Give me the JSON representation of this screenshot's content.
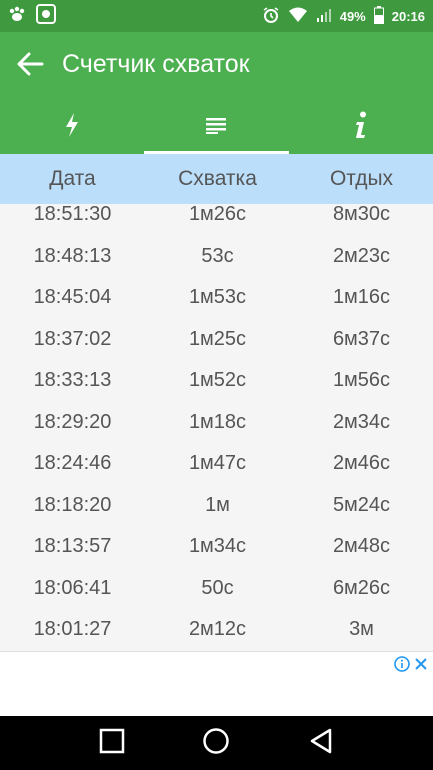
{
  "status_bar": {
    "battery_percent": "49%",
    "time": "20:16"
  },
  "app_bar": {
    "title": "Счетчик схваток"
  },
  "tabs": [
    {
      "name": "contractions",
      "icon": "lightning-icon",
      "active": false
    },
    {
      "name": "history",
      "icon": "list-icon",
      "active": true
    },
    {
      "name": "info",
      "icon": "info-icon",
      "active": false
    }
  ],
  "table": {
    "columns": [
      "Дата",
      "Схватка",
      "Отдых"
    ],
    "rows": [
      [
        "18:51:30",
        "1м26с",
        "8м30с"
      ],
      [
        "18:48:13",
        "53с",
        "2м23с"
      ],
      [
        "18:45:04",
        "1м53с",
        "1м16с"
      ],
      [
        "18:37:02",
        "1м25с",
        "6м37с"
      ],
      [
        "18:33:13",
        "1м52с",
        "1м56с"
      ],
      [
        "18:29:20",
        "1м18с",
        "2м34с"
      ],
      [
        "18:24:46",
        "1м47с",
        "2м46с"
      ],
      [
        "18:18:20",
        "1м",
        "5м24с"
      ],
      [
        "18:13:57",
        "1м34с",
        "2м48с"
      ],
      [
        "18:06:41",
        "50с",
        "6м26с"
      ],
      [
        "18:01:27",
        "2м12с",
        "3м"
      ]
    ]
  },
  "colors": {
    "app_bar": "#4caf50",
    "status_bar": "#3f9a3f",
    "header_bg": "#bbdefb",
    "ad_info": "#2196f3"
  }
}
